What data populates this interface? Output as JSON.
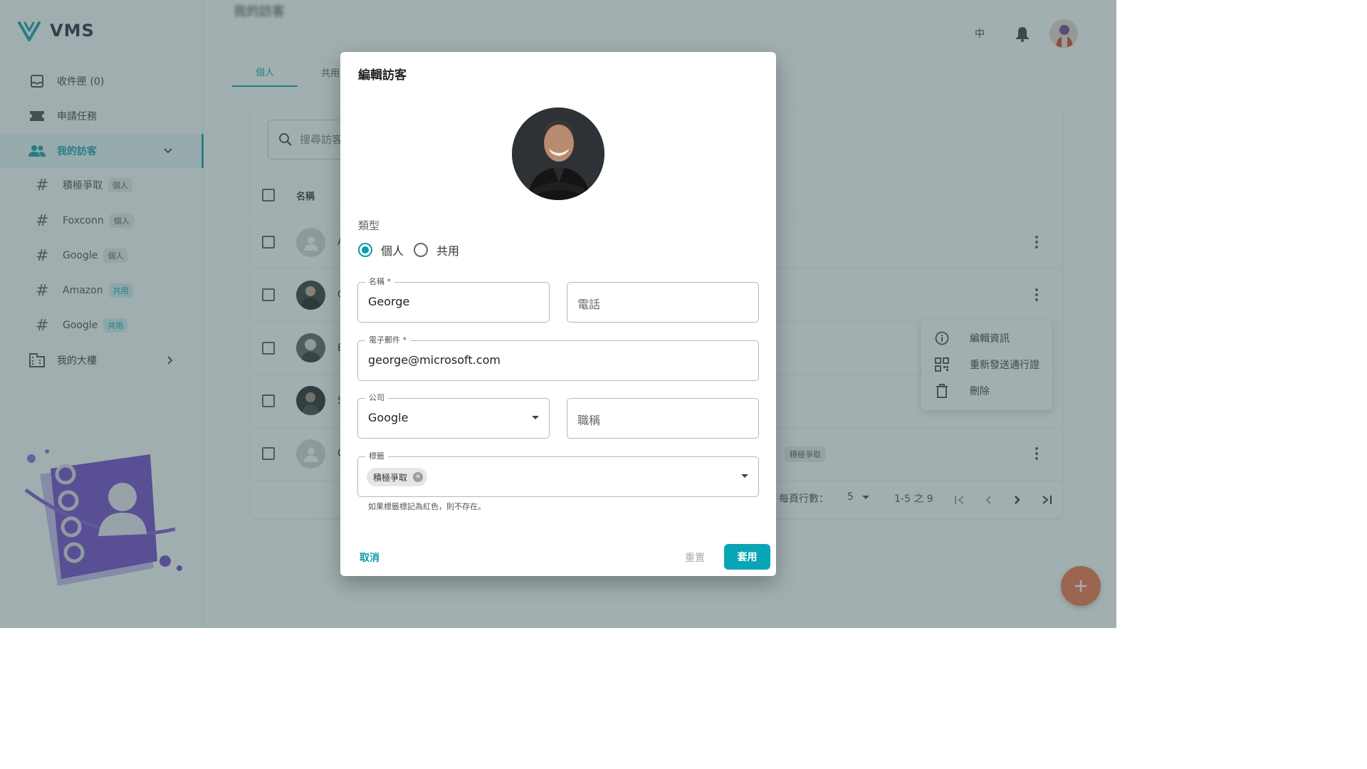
{
  "app": {
    "name": "VMS"
  },
  "colors": {
    "accent": "#0b9aab",
    "fab": "#f36b3c",
    "overlay": "rgba(70,96,98,0.5)"
  },
  "sidebar": {
    "items": [
      {
        "label": "收件匣 (0)",
        "icon": "inbox-icon"
      },
      {
        "label": "申請任務",
        "icon": "ticket-icon"
      },
      {
        "label": "我的訪客",
        "icon": "people-icon",
        "active": true,
        "expanded": true
      }
    ],
    "sub_items": [
      {
        "label": "積極爭取",
        "badge": "個人"
      },
      {
        "label": "Foxconn",
        "badge": "個人"
      },
      {
        "label": "Google",
        "badge": "個人"
      },
      {
        "label": "Amazon",
        "badge": "共用"
      },
      {
        "label": "Google",
        "badge": "共用"
      }
    ],
    "building": {
      "label": "我的大樓",
      "icon": "building-icon"
    }
  },
  "header": {
    "title": "我的訪客",
    "language": "中",
    "icons": [
      "bell-icon",
      "user-avatar"
    ]
  },
  "tabs": [
    {
      "label": "個人",
      "active": true
    },
    {
      "label": "共用",
      "active": false
    }
  ],
  "table": {
    "search_placeholder": "搜尋訪客",
    "column_name": "名稱",
    "rows": [
      {
        "initial": "A",
        "avatar": "placeholder"
      },
      {
        "initial": "G",
        "avatar": "photo"
      },
      {
        "initial": "B",
        "avatar": "photo"
      },
      {
        "initial": "S",
        "avatar": "photo"
      },
      {
        "initial": "C",
        "avatar": "placeholder",
        "tag": "積極爭取"
      }
    ],
    "rows_per_page_label": "每頁行數：",
    "rows_per_page": "5",
    "range": "1-5 之 9"
  },
  "context_menu": [
    {
      "label": "編輯資訊",
      "icon": "info-icon"
    },
    {
      "label": "重新發送通行證",
      "icon": "qr-code-icon"
    },
    {
      "label": "刪除",
      "icon": "trash-icon"
    }
  ],
  "dialog": {
    "title": "編輯訪客",
    "type_label": "類型",
    "type_options": [
      "個人",
      "共用"
    ],
    "type_selected": "個人",
    "name_label": "名稱 *",
    "name_value": "George",
    "phone_placeholder": "電話",
    "email_label": "電子郵件 *",
    "email_value": "george@microsoft.com",
    "company_label": "公司",
    "company_value": "Google",
    "title_placeholder": "職稱",
    "tags_label": "標籤",
    "tags": [
      "積極爭取"
    ],
    "helper_text": "如果標籤標記為紅色，則不存在。",
    "cancel_label": "取消",
    "reset_label": "重置",
    "apply_label": "套用"
  }
}
